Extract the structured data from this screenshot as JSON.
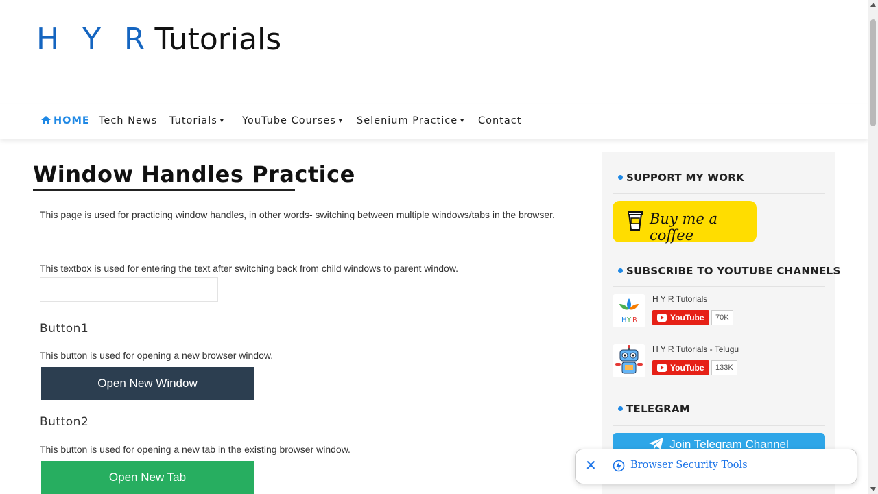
{
  "logo": {
    "hyr": "H Y R",
    "tutorials": "Tutorials"
  },
  "nav": {
    "home": "HOME",
    "tech_news": "Tech News",
    "tutorials": "Tutorials",
    "youtube_courses": "YouTube Courses",
    "selenium_practice": "Selenium Practice",
    "contact": "Contact"
  },
  "main": {
    "title": "Window Handles Practice",
    "intro": "This page is used for practicing window handles, in other words- switching between multiple windows/tabs in the browser.",
    "textbox_desc": "This textbox is used for entering the text after switching back from child windows to parent window.",
    "textbox_value": "",
    "button1_heading": "Button1",
    "button1_desc": "This button is used for opening a new browser window.",
    "button1_label": "Open New Window",
    "button2_heading": "Button2",
    "button2_desc": "This button is used for opening a new tab in the existing browser window.",
    "button2_label": "Open New Tab"
  },
  "sidebar": {
    "support_title": "SUPPORT MY WORK",
    "coffee_label": "Buy me a coffee",
    "subscribe_title": "SUBSCRIBE TO YOUTUBE CHANNELS",
    "channels": [
      {
        "name": "H Y R Tutorials",
        "button": "YouTube",
        "count": "70K"
      },
      {
        "name": "H Y R Tutorials - Telugu",
        "button": "YouTube",
        "count": "133K"
      }
    ],
    "telegram_title": "TELEGRAM",
    "telegram_button": "Join Telegram Channel"
  },
  "popup": {
    "label": "Browser Security Tools",
    "close": "✕"
  },
  "colors": {
    "accent": "#1e88e5",
    "dark_button": "#2c3e50",
    "green_button": "#27ae60",
    "coffee": "#ffdd00",
    "youtube_red": "#e62117",
    "telegram": "#2ea6e8"
  }
}
